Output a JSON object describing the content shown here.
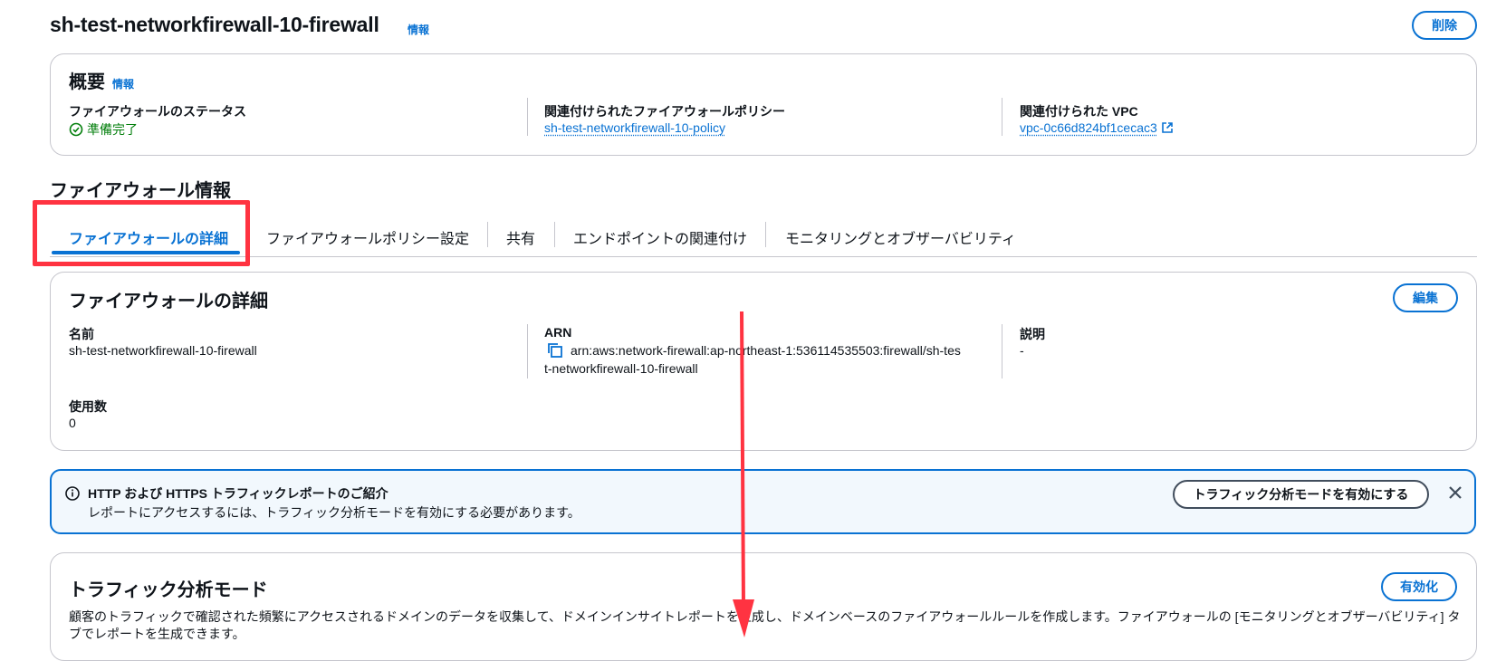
{
  "header": {
    "title": "sh-test-networkfirewall-10-firewall",
    "info": "情報",
    "delete_label": "削除"
  },
  "overview": {
    "heading": "概要",
    "info": "情報",
    "status_label": "ファイアウォールのステータス",
    "status_value": "準備完了",
    "policy_label": "関連付けられたファイアウォールポリシー",
    "policy_value": "sh-test-networkfirewall-10-policy",
    "vpc_label": "関連付けられた VPC",
    "vpc_value": "vpc-0c66d824bf1cecac3"
  },
  "firewall_info": {
    "heading": "ファイアウォール情報",
    "tabs": [
      {
        "label": "ファイアウォールの詳細"
      },
      {
        "label": "ファイアウォールポリシー設定"
      },
      {
        "label": "共有"
      },
      {
        "label": "エンドポイントの関連付け"
      },
      {
        "label": "モニタリングとオブザーバビリティ"
      }
    ],
    "active_tab": "ファイアウォールの詳細"
  },
  "details": {
    "heading": "ファイアウォールの詳細",
    "edit_label": "編集",
    "name_label": "名前",
    "name_value": "sh-test-networkfirewall-10-firewall",
    "arn_label": "ARN",
    "arn_line1": "arn:aws:network-firewall:ap-northeast-1:536114535503:firewall/sh-tes",
    "arn_line2": "t-networkfirewall-10-firewall",
    "desc_label": "説明",
    "desc_value": "-",
    "usage_label": "使用数",
    "usage_value": "0"
  },
  "flash": {
    "title": "HTTP および HTTPS トラフィックレポートのご紹介",
    "message": "レポートにアクセスするには、トラフィック分析モードを有効にする必要があります。",
    "action_label": "トラフィック分析モードを有効にする"
  },
  "traffic": {
    "heading": "トラフィック分析モード",
    "enable_label": "有効化",
    "desc_line1": "顧客のトラフィックで確認された頻繁にアクセスされるドメインのデータを収集して、ドメインインサイトレポートを生成し、ドメインベースのファイアウォールルールを作成します。ファイアウォールの [モニタリングとオブザーバビリティ] タ",
    "desc_line2": "ブでレポートを生成できます。"
  },
  "colors": {
    "accent": "#0972d3",
    "success": "#037f0c",
    "annotation": "#ff3341"
  }
}
